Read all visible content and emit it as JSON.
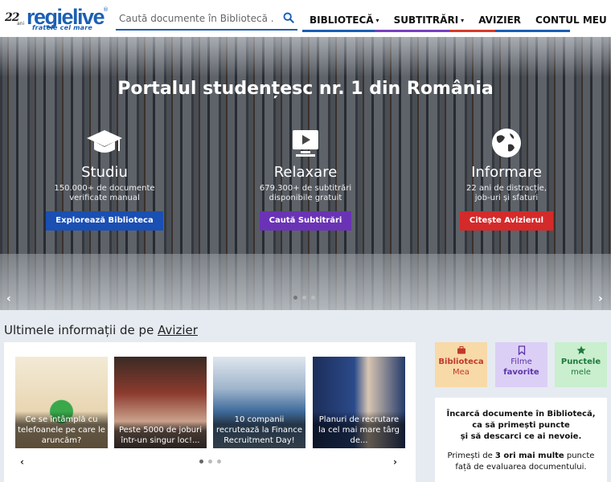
{
  "header": {
    "logo_years": "22",
    "logo_years_suffix": "ani",
    "logo_name": "regielive",
    "logo_reg": "®",
    "logo_tagline": "fratele cel mare",
    "search_placeholder": "Caută documente în Bibliotecă .",
    "nav": [
      {
        "label": "BIBLIOTECĂ",
        "caret": "▾"
      },
      {
        "label": "SUBTITRĂRI",
        "caret": "▾"
      },
      {
        "label": "AVIZIER",
        "caret": ""
      },
      {
        "label": "CONTUL MEU",
        "caret": ""
      }
    ],
    "accent": "#1b5fb5"
  },
  "hero": {
    "title": "Portalul studențesc nr. 1 din România",
    "columns": [
      {
        "icon": "graduation-cap-icon",
        "title": "Studiu",
        "desc": "150.000+ de documente\nverificate manual",
        "button": "Explorează Biblioteca",
        "color": "#1a4fb3"
      },
      {
        "icon": "video-play-icon",
        "title": "Relaxare",
        "desc": "679.300+ de subtitrări\ndisponibile gratuit",
        "button": "Caută Subtitrări",
        "color": "#6a33b5"
      },
      {
        "icon": "globe-icon",
        "title": "Informare",
        "desc": "22 ani de distracție,\njob-uri și sfaturi",
        "button": "Citește Avizierul",
        "color": "#d42a2a"
      }
    ],
    "prev": "‹",
    "next": "›"
  },
  "avizier": {
    "title_prefix": "Ultimele informații de pe ",
    "title_link": "Avizier",
    "cards": [
      {
        "text": "Ce se întâmplă cu telefoanele pe care le aruncăm?"
      },
      {
        "text": "Peste 5000 de joburi într-un singur loc!..."
      },
      {
        "text": "10 companii recrutează la Finance Recruitment Day!"
      },
      {
        "text": "Planuri de recrutare la cel mai mare târg de..."
      }
    ],
    "prev": "‹",
    "next": "›"
  },
  "tiles": [
    {
      "icon": "briefcase-icon",
      "line1": "Biblioteca",
      "line2": "Mea",
      "bg": "#f8d9a8",
      "color": "#c0392b"
    },
    {
      "icon": "bookmark-icon",
      "line1": "Filme",
      "line2": "favorite",
      "bg": "#dccff5",
      "color": "#5b34a8"
    },
    {
      "icon": "star-icon",
      "line1": "Punctele",
      "line2": "mele",
      "bg": "#c9efcf",
      "color": "#1f7a3a"
    }
  ],
  "promo": {
    "line1": "Încarcă documente în Bibliotecă,",
    "line2": "ca să primești puncte",
    "line3": "și să descarci ce ai nevoie.",
    "line4_pre": "Primești de ",
    "line4_bold": "3 ori mai multe",
    "line4_post": " puncte",
    "line5": "față de evaluarea documentului."
  }
}
